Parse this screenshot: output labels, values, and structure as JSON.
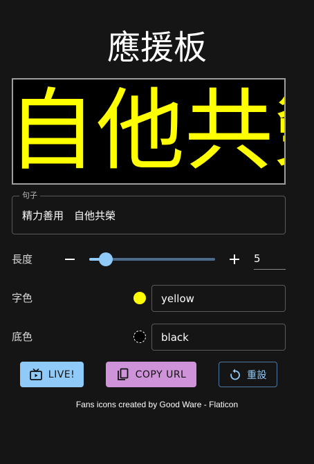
{
  "app": {
    "title": "應援板"
  },
  "preview": {
    "text": "自他共榮",
    "text_color": "#ffff00",
    "background_color": "#000000"
  },
  "sentence": {
    "label": "句子",
    "value": "精力善用　自他共榮"
  },
  "length": {
    "label": "長度",
    "value": "5",
    "slider_fraction": 0.12,
    "decrease_icon": "minus-icon",
    "increase_icon": "plus-icon"
  },
  "text_color": {
    "label": "字色",
    "value": "yellow",
    "swatch": "#ffff00"
  },
  "background_color": {
    "label": "底色",
    "value": "black",
    "swatch": "#000000"
  },
  "buttons": {
    "live": {
      "label": "LIVE!",
      "icon": "live-tv-icon",
      "color": "#90caf9"
    },
    "copy_url": {
      "label": "COPY URL",
      "icon": "copy-icon",
      "color": "#ce93d8"
    },
    "reset": {
      "label": "重設",
      "icon": "reset-icon",
      "color": "#90caf9"
    }
  },
  "footer": {
    "credit": "Fans icons created by Good Ware - Flaticon"
  }
}
